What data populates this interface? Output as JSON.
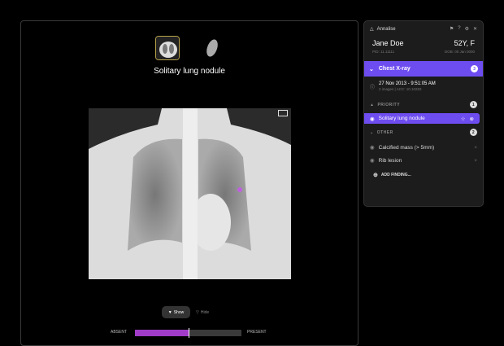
{
  "viewer": {
    "title": "Solitary lung nodule",
    "show_label": "Show",
    "hide_label": "Hide",
    "scale_min": "ABSENT",
    "scale_max": "PRESENT",
    "confidence": 0.5,
    "rotate_icon": "rotate-icon"
  },
  "panel": {
    "app_name": "Annalise",
    "patient": {
      "name": "Jane Doe",
      "age_sex": "52Y, F",
      "pid": "PID: 11.11111",
      "dob": "DOB: 00 Jan 0000"
    },
    "study": {
      "label": "Chest X-ray",
      "count": "3",
      "datetime": "27 Nov 2013 - 9:51:05 AM",
      "meta": "2 images | ACC: 10.10283"
    },
    "priority": {
      "label": "PRIORITY",
      "count": "1",
      "findings": [
        {
          "label": "Solitary lung nodule"
        }
      ]
    },
    "other": {
      "label": "OTHER",
      "count": "2",
      "findings": [
        {
          "label": "Calcified mass (> 5mm)"
        },
        {
          "label": "Rib lesion"
        }
      ]
    },
    "add_finding": "ADD FINDING..."
  },
  "colors": {
    "accent": "#6e4df0",
    "slider": "#a03cc8"
  }
}
